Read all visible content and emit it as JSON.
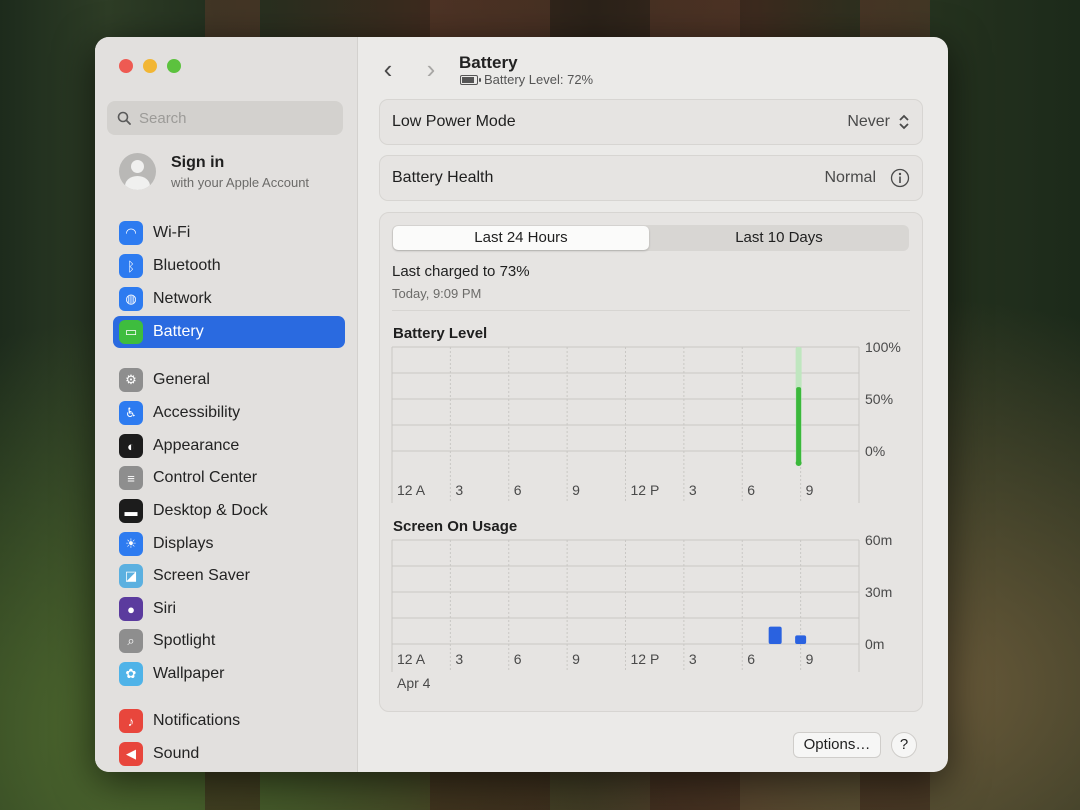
{
  "window": {
    "title": "Battery",
    "subtitle": "Battery Level: 72%",
    "battery_level": 0.72
  },
  "sidebar": {
    "search_placeholder": "Search",
    "account": {
      "title": "Sign in",
      "subtitle": "with your Apple Account"
    },
    "items": [
      {
        "label": "Wi-Fi",
        "icon": "wifi-icon",
        "color": "#2d7bf0"
      },
      {
        "label": "Bluetooth",
        "icon": "bluetooth-icon",
        "color": "#2d7bf0"
      },
      {
        "label": "Network",
        "icon": "globe-icon",
        "color": "#2d7bf0"
      },
      {
        "label": "Battery",
        "icon": "battery-icon",
        "color": "#3ebd3e",
        "active": true
      },
      {
        "label": "General",
        "icon": "gear-icon",
        "color": "#8e8e8e"
      },
      {
        "label": "Accessibility",
        "icon": "accessibility-icon",
        "color": "#2d7bf0"
      },
      {
        "label": "Appearance",
        "icon": "appearance-icon",
        "color": "#1c1c1c"
      },
      {
        "label": "Control Center",
        "icon": "control-center-icon",
        "color": "#8e8e8e"
      },
      {
        "label": "Desktop & Dock",
        "icon": "dock-icon",
        "color": "#1c1c1c"
      },
      {
        "label": "Displays",
        "icon": "sun-icon",
        "color": "#2d7bf0"
      },
      {
        "label": "Screen Saver",
        "icon": "screen-saver-icon",
        "color": "#5bb0e0"
      },
      {
        "label": "Siri",
        "icon": "siri-icon",
        "color": "#5b3b9e"
      },
      {
        "label": "Spotlight",
        "icon": "magnifier-icon",
        "color": "#8e8e8e"
      },
      {
        "label": "Wallpaper",
        "icon": "flower-icon",
        "color": "#4fb3e8"
      },
      {
        "label": "Notifications",
        "icon": "bell-icon",
        "color": "#e8463c"
      },
      {
        "label": "Sound",
        "icon": "speaker-icon",
        "color": "#e8463c"
      }
    ]
  },
  "main": {
    "low_power": {
      "label": "Low Power Mode",
      "value": "Never"
    },
    "health": {
      "label": "Battery Health",
      "value": "Normal"
    },
    "tabs": [
      {
        "label": "Last 24 Hours",
        "selected": true
      },
      {
        "label": "Last 10 Days",
        "selected": false
      }
    ],
    "last_charged": "Last charged to 73%",
    "last_charged_time": "Today, 9:09 PM",
    "options_label": "Options…",
    "help_label": "?"
  },
  "chart_data": [
    {
      "type": "bar",
      "title": "Battery Level",
      "x_ticks": [
        "12 A",
        "3",
        "6",
        "9",
        "12 P",
        "3",
        "6",
        "9"
      ],
      "y_ticks": [
        "100%",
        "50%",
        "0%"
      ],
      "ylim": [
        0,
        100
      ],
      "values": [
        {
          "hour": 21,
          "value": 73
        }
      ],
      "color": "#3bb83b",
      "grid": true
    },
    {
      "type": "bar",
      "title": "Screen On Usage",
      "x_ticks": [
        "12 A",
        "3",
        "6",
        "9",
        "12 P",
        "3",
        "6",
        "9"
      ],
      "y_ticks": [
        "60m",
        "30m",
        "0m"
      ],
      "ylim": [
        0,
        60
      ],
      "date_label": "Apr 4",
      "values": [
        {
          "hour": 20,
          "value": 10
        },
        {
          "hour": 21,
          "value": 5
        }
      ],
      "color": "#2a62e0",
      "grid": true
    }
  ]
}
